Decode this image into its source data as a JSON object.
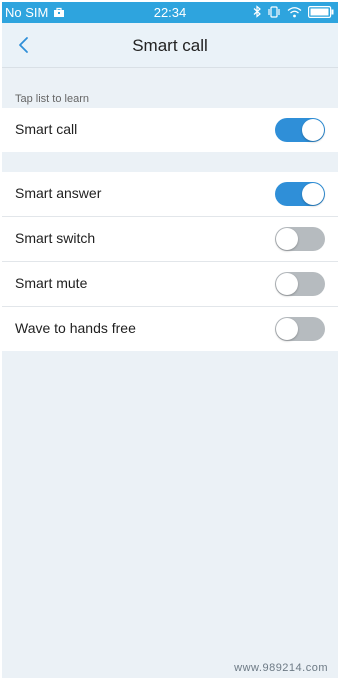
{
  "status_bar": {
    "carrier": "No SIM",
    "time": "22:34"
  },
  "header": {
    "title": "Smart call"
  },
  "caption": "Tap list to learn",
  "group1": [
    {
      "label": "Smart call",
      "on": true
    }
  ],
  "group2": [
    {
      "label": "Smart answer",
      "on": true
    },
    {
      "label": "Smart switch",
      "on": false
    },
    {
      "label": "Smart mute",
      "on": false
    },
    {
      "label": "Wave to hands free",
      "on": false
    }
  ],
  "watermark": "www.989214.com",
  "colors": {
    "status_bar": "#2ea4de",
    "toggle_on": "#2f8fd8",
    "toggle_off": "#b6bbbf"
  }
}
